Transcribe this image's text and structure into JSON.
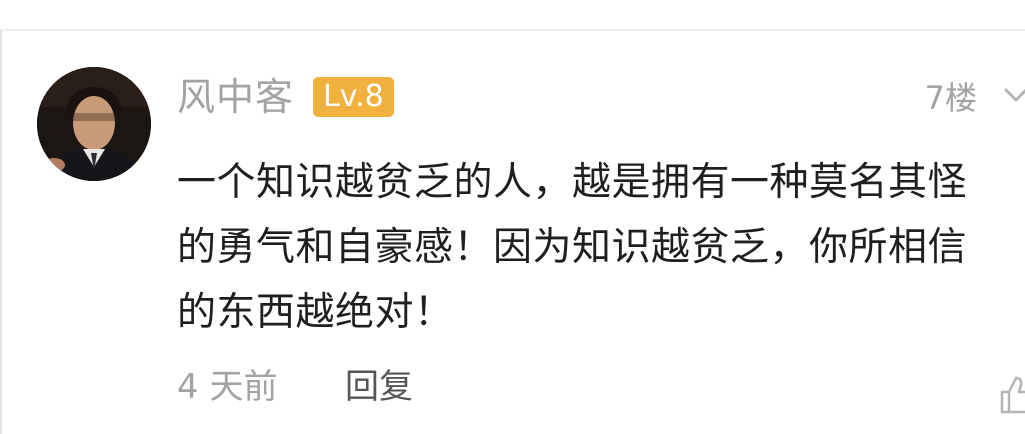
{
  "comment": {
    "username": "风中客",
    "level": "Lv.8",
    "floor": "7楼",
    "text": "一个知识越贫乏的人，越是拥有一种莫名其怪\n的勇气和自豪感！因为知识越贫乏，你所相信\n的东西越绝对！",
    "time": "4 天前",
    "reply_label": "回复"
  },
  "icons": {
    "avatar": "profile-avatar",
    "more": "chevron-down-icon",
    "like": "thumbs-up-icon"
  },
  "colors": {
    "meta_gray": "#a3a3a3",
    "level_badge": "#f1b13f",
    "body_text": "#1f1f1f",
    "reply_text": "#555555"
  }
}
